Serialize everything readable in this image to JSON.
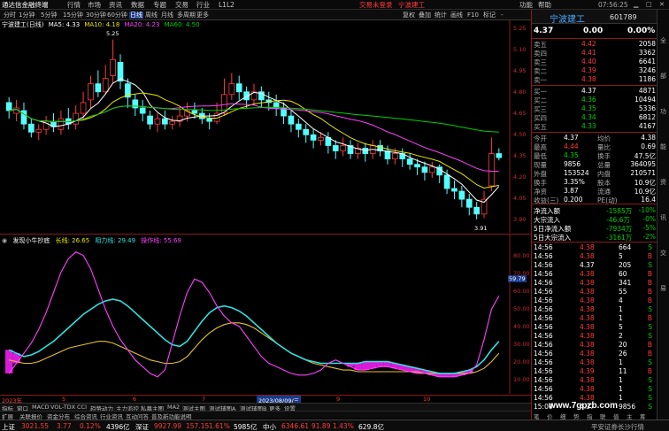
{
  "titlebar": {
    "app_name": "通达信金融终端",
    "menu": [
      "行情",
      "市场",
      "资讯",
      "数据",
      "专题",
      "交易",
      "行业",
      "L1L2"
    ],
    "trade_login": "交易未登录",
    "stock_title": "宁波建工",
    "right_menu": [
      "功能",
      "帮助"
    ],
    "clock": "07:56:25"
  },
  "toolbar": {
    "items": [
      "分时",
      "1分钟",
      "5分钟",
      "15分钟",
      "30分钟",
      "60分钟",
      "日线",
      "周线",
      "月线",
      "多周期",
      "更多"
    ],
    "right_items": [
      "复权",
      "叠加",
      "统计",
      "画线",
      "F10",
      "标记",
      "-"
    ]
  },
  "chart_head": {
    "title": "宁波建工(日线)",
    "ma5": "MA5: 4.33",
    "ma10": "MA10: 4.18",
    "ma20": "MA20: 4.23",
    "ma60": "MA60: 4.50"
  },
  "kline_axis": [
    "5.25",
    "5.10",
    "4.95",
    "4.80",
    "4.65",
    "4.50",
    "4.35",
    "4.20",
    "4.05",
    "3.90"
  ],
  "kline_marks": {
    "high": "5.25",
    "low": "3.91"
  },
  "indicator_head": {
    "name": "发现小牛抄底",
    "long_line": "长线: 26.65",
    "resistance": "阻力线: 29.49",
    "operate": "操作线: 55.69"
  },
  "indicator_axis": [
    "80.00",
    "70.00",
    "60.00",
    "50.00",
    "40.00",
    "30.00",
    "20.00",
    "10.00"
  ],
  "indicator_value_tag": "59.79",
  "datebar": {
    "year": "2023年",
    "months": [
      "5",
      "6",
      "7",
      "8",
      "9",
      "10"
    ],
    "cursor_date": "2023/08/09/三"
  },
  "tabs": [
    "指标",
    "窗口",
    "MACD",
    "VOL-TDX",
    "CCI",
    "趋势动力",
    "主力监控",
    "私募主图",
    "MA2",
    "测试主图",
    "测试辅图A",
    "测试辅图B",
    "更多",
    "设置"
  ],
  "tabs2": [
    "扩展",
    "关联报价",
    "资金分布",
    "综合资讯",
    "行业资讯",
    "互动问答",
    "普及新功能说明"
  ],
  "right_panel": {
    "stock_name": "宁波建工",
    "stock_code": "601789",
    "price": "4.37",
    "change": "0.00",
    "change_pct": "0.00%",
    "asks": [
      {
        "label": "卖五",
        "price": "4.42",
        "vol": "2058"
      },
      {
        "label": "卖四",
        "price": "4.41",
        "vol": "3362"
      },
      {
        "label": "卖三",
        "price": "4.40",
        "vol": "6641"
      },
      {
        "label": "卖二",
        "price": "4.39",
        "vol": "3246"
      },
      {
        "label": "卖一",
        "price": "4.38",
        "vol": "1186"
      }
    ],
    "bids": [
      {
        "label": "买一",
        "price": "4.37",
        "vol": "4871"
      },
      {
        "label": "买二",
        "price": "4.36",
        "vol": "10494"
      },
      {
        "label": "买三",
        "price": "4.35",
        "vol": "5336"
      },
      {
        "label": "买四",
        "price": "4.34",
        "vol": "6812"
      },
      {
        "label": "买五",
        "price": "4.33",
        "vol": "4167"
      }
    ],
    "stats": [
      {
        "l1": "今开",
        "v1": "4.37",
        "l2": "均价",
        "v2": "4.38"
      },
      {
        "l1": "最高",
        "v1": "4.44",
        "l2": "量比",
        "v2": "0.69"
      },
      {
        "l1": "最低",
        "v1": "4.35",
        "l2": "换手",
        "v2": "47.5亿"
      },
      {
        "l1": "现量",
        "v1": "9856",
        "l2": "总量",
        "v2": "364095"
      },
      {
        "l1": "外盘",
        "v1": "153524",
        "l2": "内盘",
        "v2": "210571"
      },
      {
        "l1": "换手",
        "v1": "3.35%",
        "l2": "股本",
        "v2": "10.9亿"
      },
      {
        "l1": "净资",
        "v1": "3.87",
        "l2": "流通",
        "v2": "10.9亿"
      },
      {
        "l1": "收益(三)",
        "v1": "0.200",
        "l2": "PE(动)",
        "v2": "16.4"
      }
    ],
    "flows": [
      {
        "label": "净流入额",
        "value": "-1585万",
        "pct": "-10%"
      },
      {
        "label": "大宗流入",
        "value": "-46.6万",
        "pct": "-0%"
      },
      {
        "label": "5日净流入额",
        "value": "-7934万",
        "pct": "-5%"
      },
      {
        "label": "5日大宗流入",
        "value": "-3161万",
        "pct": "-2%"
      }
    ],
    "ticks": [
      {
        "t": "14:56",
        "p": "4.38",
        "v": "664",
        "d": "S"
      },
      {
        "t": "14:56",
        "p": "4.38",
        "v": "5",
        "d": "B"
      },
      {
        "t": "14:56",
        "p": "4.37",
        "v": "205",
        "d": "S"
      },
      {
        "t": "14:56",
        "p": "4.38",
        "v": "60",
        "d": "B"
      },
      {
        "t": "14:56",
        "p": "4.38",
        "v": "341",
        "d": "B"
      },
      {
        "t": "14:56",
        "p": "4.38",
        "v": "55",
        "d": "B"
      },
      {
        "t": "14:56",
        "p": "4.38",
        "v": "4",
        "d": "B"
      },
      {
        "t": "14:56",
        "p": "4.38",
        "v": "1",
        "d": "S"
      },
      {
        "t": "14:56",
        "p": "4.38",
        "v": "1",
        "d": "B"
      },
      {
        "t": "14:56",
        "p": "4.38",
        "v": "5",
        "d": "S"
      },
      {
        "t": "14:56",
        "p": "4.38",
        "v": "2",
        "d": "S"
      },
      {
        "t": "14:56",
        "p": "4.38",
        "v": "20",
        "d": "B"
      },
      {
        "t": "14:56",
        "p": "4.38",
        "v": "26",
        "d": "B"
      },
      {
        "t": "14:56",
        "p": "4.38",
        "v": "1",
        "d": "S"
      },
      {
        "t": "14:56",
        "p": "4.39",
        "v": "11",
        "d": "B"
      },
      {
        "t": "14:56",
        "p": "4.38",
        "v": "1",
        "d": "S"
      },
      {
        "t": "14:56",
        "p": "4.38",
        "v": "1",
        "d": "S"
      },
      {
        "t": "14:56",
        "p": "4.38",
        "v": "1",
        "d": "S"
      },
      {
        "t": "15:00",
        "p": "4.37",
        "v": "9856",
        "d": "S"
      }
    ],
    "footer": [
      "笔",
      "价",
      "细",
      "势",
      "指",
      "联",
      "值",
      "主",
      "筹"
    ]
  },
  "statusbar": {
    "sh_label": "上证",
    "sh_val": "3021.55",
    "sh_chg": "3.77",
    "sh_pct": "0.12%",
    "sh_amt": "4396亿",
    "sz_label": "深证",
    "sz_val": "9927.99",
    "sz_chg": "157.15",
    "sz_pct": "1.61%",
    "sz_amt": "5985亿",
    "zx_label": "中小",
    "zx_val": "6346.61",
    "zx_chg": "91.89",
    "zx_pct": "1.43%",
    "zx_amt": "629.8亿",
    "right_text": "平安证券长沙行情"
  },
  "sidebar": [
    "全",
    "部",
    "功",
    "能",
    "资",
    "讯",
    "交",
    "易"
  ],
  "watermark": "www.7gpzb.com",
  "chart_data": [
    {
      "type": "candlestick",
      "title": "宁波建工(日线)",
      "ylim": [
        3.85,
        5.3
      ],
      "ohlc": [
        [
          4.78,
          4.72,
          4.82,
          4.66
        ],
        [
          4.7,
          4.74,
          4.8,
          4.64
        ],
        [
          4.72,
          4.62,
          4.78,
          4.58
        ],
        [
          4.62,
          4.56,
          4.66,
          4.52
        ],
        [
          4.56,
          4.58,
          4.62,
          4.5
        ],
        [
          4.58,
          4.64,
          4.68,
          4.54
        ],
        [
          4.64,
          4.6,
          4.7,
          4.56
        ],
        [
          4.58,
          4.66,
          4.72,
          4.54
        ],
        [
          4.66,
          4.62,
          4.74,
          4.58
        ],
        [
          4.62,
          4.7,
          4.76,
          4.58
        ],
        [
          4.7,
          4.78,
          4.86,
          4.66
        ],
        [
          4.8,
          4.92,
          4.98,
          4.74
        ],
        [
          4.92,
          4.86,
          5.02,
          4.82
        ],
        [
          4.86,
          4.96,
          5.06,
          4.84
        ],
        [
          4.98,
          5.1,
          5.25,
          4.92
        ],
        [
          5.08,
          4.94,
          5.14,
          4.88
        ],
        [
          4.92,
          4.82,
          4.96,
          4.74
        ],
        [
          4.8,
          4.74,
          4.84,
          4.68
        ],
        [
          4.74,
          4.7,
          4.8,
          4.64
        ],
        [
          4.68,
          4.62,
          4.72,
          4.58
        ],
        [
          4.62,
          4.66,
          4.7,
          4.56
        ],
        [
          4.66,
          4.62,
          4.72,
          4.58
        ],
        [
          4.62,
          4.64,
          4.68,
          4.58
        ],
        [
          4.64,
          4.68,
          4.74,
          4.6
        ],
        [
          4.68,
          4.72,
          4.78,
          4.64
        ],
        [
          4.72,
          4.7,
          4.78,
          4.66
        ],
        [
          4.7,
          4.66,
          4.74,
          4.62
        ],
        [
          4.66,
          4.64,
          4.7,
          4.58
        ],
        [
          4.64,
          4.7,
          4.78,
          4.62
        ],
        [
          4.7,
          4.84,
          4.96,
          4.68
        ],
        [
          4.84,
          4.92,
          5.0,
          4.8
        ],
        [
          4.92,
          4.86,
          4.98,
          4.8
        ],
        [
          4.86,
          4.8,
          4.9,
          4.74
        ],
        [
          4.8,
          4.86,
          4.92,
          4.76
        ],
        [
          4.86,
          4.8,
          4.9,
          4.74
        ],
        [
          4.8,
          4.78,
          4.86,
          4.72
        ],
        [
          4.78,
          4.74,
          4.84,
          4.68
        ],
        [
          4.74,
          4.68,
          4.78,
          4.62
        ],
        [
          4.68,
          4.62,
          4.72,
          4.56
        ],
        [
          4.62,
          4.58,
          4.66,
          4.52
        ],
        [
          4.58,
          4.54,
          4.62,
          4.48
        ],
        [
          4.54,
          4.5,
          4.58,
          4.44
        ],
        [
          4.5,
          4.52,
          4.56,
          4.46
        ],
        [
          4.52,
          4.46,
          4.56,
          4.4
        ],
        [
          4.46,
          4.42,
          4.5,
          4.36
        ],
        [
          4.42,
          4.46,
          4.52,
          4.38
        ],
        [
          4.46,
          4.4,
          4.5,
          4.36
        ],
        [
          4.4,
          4.44,
          4.48,
          4.36
        ],
        [
          4.44,
          4.4,
          4.48,
          4.34
        ],
        [
          4.4,
          4.46,
          4.5,
          4.36
        ],
        [
          4.46,
          4.42,
          4.5,
          4.38
        ],
        [
          4.42,
          4.36,
          4.46,
          4.32
        ],
        [
          4.36,
          4.4,
          4.44,
          4.32
        ],
        [
          4.4,
          4.36,
          4.44,
          4.3
        ],
        [
          4.36,
          4.32,
          4.4,
          4.28
        ],
        [
          4.32,
          4.3,
          4.36,
          4.24
        ],
        [
          4.3,
          4.26,
          4.34,
          4.2
        ],
        [
          4.26,
          4.3,
          4.34,
          4.22
        ],
        [
          4.3,
          4.24,
          4.32,
          4.18
        ],
        [
          4.24,
          4.14,
          4.28,
          4.1
        ],
        [
          4.14,
          4.12,
          4.2,
          4.06
        ],
        [
          4.12,
          4.06,
          4.16,
          4.0
        ],
        [
          4.06,
          4.0,
          4.1,
          3.94
        ],
        [
          4.0,
          3.95,
          4.04,
          3.91
        ],
        [
          3.95,
          4.06,
          4.12,
          3.92
        ],
        [
          4.16,
          4.4,
          4.52,
          4.12
        ],
        [
          4.4,
          4.37,
          4.44,
          4.35
        ]
      ]
    },
    {
      "type": "line",
      "title": "发现小牛抄底",
      "ylim": [
        0,
        85
      ],
      "series": [
        {
          "name": "长线",
          "color": "#e8c030",
          "values": [
            18,
            17,
            16,
            16,
            17,
            19,
            21,
            23,
            25,
            26,
            27,
            28,
            29,
            29,
            28,
            26,
            24,
            22,
            20,
            18,
            17,
            16,
            16,
            17,
            20,
            25,
            30,
            34,
            37,
            39,
            40,
            40,
            39,
            37,
            34,
            31,
            28,
            25,
            22,
            20,
            18,
            16,
            15,
            14,
            13,
            12,
            12,
            11,
            11,
            11,
            11,
            11,
            11,
            11,
            11,
            11,
            10,
            10,
            10,
            10,
            10,
            10,
            10,
            11,
            13,
            17,
            22
          ]
        },
        {
          "name": "阻力线",
          "color": "#30e0e0",
          "values": [
            24,
            22,
            20,
            21,
            23,
            26,
            29,
            33,
            37,
            41,
            45,
            48,
            51,
            53,
            54,
            53,
            50,
            46,
            42,
            38,
            34,
            30,
            27,
            26,
            29,
            35,
            41,
            46,
            49,
            50,
            49,
            47,
            44,
            40,
            36,
            32,
            28,
            25,
            22,
            20,
            18,
            17,
            16,
            16,
            16,
            16,
            16,
            16,
            17,
            17,
            17,
            17,
            16,
            15,
            14,
            13,
            12,
            11,
            10,
            10,
            10,
            11,
            12,
            14,
            18,
            24,
            29
          ]
        },
        {
          "name": "操作线",
          "color": "#ff40ff",
          "values": [
            10,
            16,
            22,
            28,
            36,
            46,
            58,
            70,
            78,
            82,
            80,
            72,
            60,
            48,
            38,
            30,
            24,
            18,
            14,
            10,
            8,
            12,
            28,
            44,
            58,
            66,
            64,
            58,
            50,
            44,
            40,
            38,
            32,
            26,
            20,
            16,
            14,
            12,
            10,
            9,
            9,
            10,
            12,
            16,
            18,
            16,
            14,
            12,
            12,
            13,
            14,
            14,
            13,
            12,
            11,
            10,
            10,
            9,
            8,
            8,
            8,
            9,
            10,
            15,
            30,
            48,
            56
          ]
        }
      ]
    }
  ]
}
